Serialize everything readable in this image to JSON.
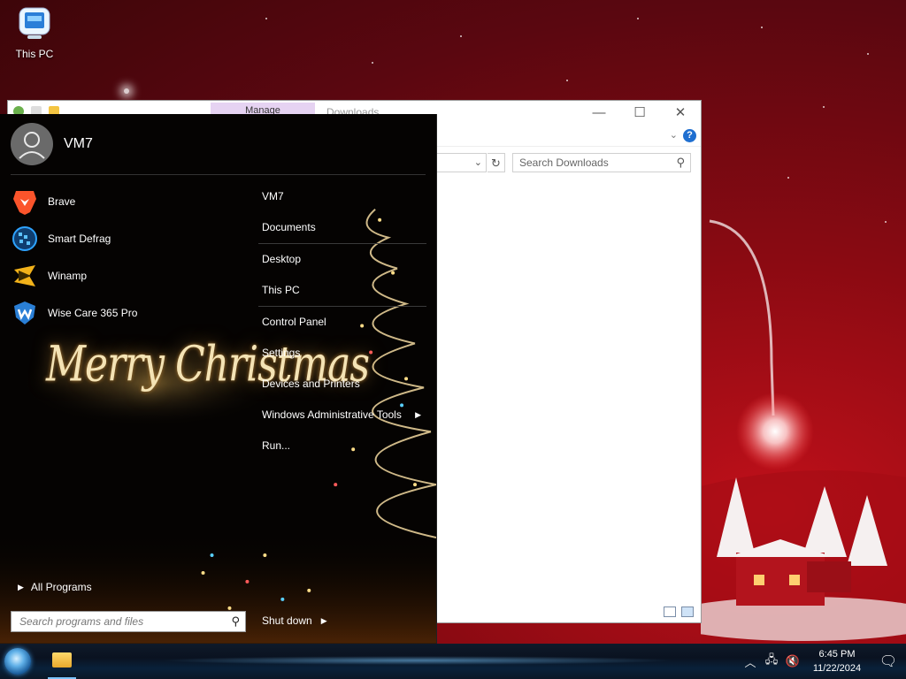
{
  "desktop": {
    "icons": [
      {
        "label": "This PC",
        "icon": "computer-icon"
      }
    ]
  },
  "explorer": {
    "window_title": "Downloads",
    "ribbon_tab": "Manage",
    "search_placeholder": "Search Downloads",
    "controls": {
      "minimize": "—",
      "maximize": "☐",
      "close": "✕"
    }
  },
  "start_menu": {
    "user_name": "VM7",
    "pinned": [
      {
        "label": "Brave",
        "icon": "brave-icon",
        "color": "#fb542b"
      },
      {
        "label": "Smart Defrag",
        "icon": "smart-defrag-icon",
        "color": "#1e88d9"
      },
      {
        "label": "Winamp",
        "icon": "winamp-icon",
        "color": "#f2b21a"
      },
      {
        "label": "Wise Care 365 Pro",
        "icon": "wise-care-icon",
        "color": "#2a7fd6"
      }
    ],
    "decoration_text": "Merry Christmas",
    "right_links": [
      {
        "label": "VM7"
      },
      {
        "label": "Documents"
      },
      {
        "label": "Desktop"
      },
      {
        "label": "This PC"
      },
      {
        "label": "Control Panel"
      },
      {
        "label": "Settings"
      },
      {
        "label": "Devices and Printers"
      },
      {
        "label": "Windows Administrative Tools",
        "has_submenu": true
      },
      {
        "label": "Run..."
      }
    ],
    "all_programs": "All Programs",
    "search_placeholder": "Search programs and files",
    "shutdown_label": "Shut down"
  },
  "taskbar": {
    "time": "6:45 PM",
    "date": "11/22/2024",
    "tray_icons": [
      "chevron-up-icon",
      "network-icon",
      "volume-muted-icon"
    ],
    "notification_icon": "action-center-icon"
  }
}
